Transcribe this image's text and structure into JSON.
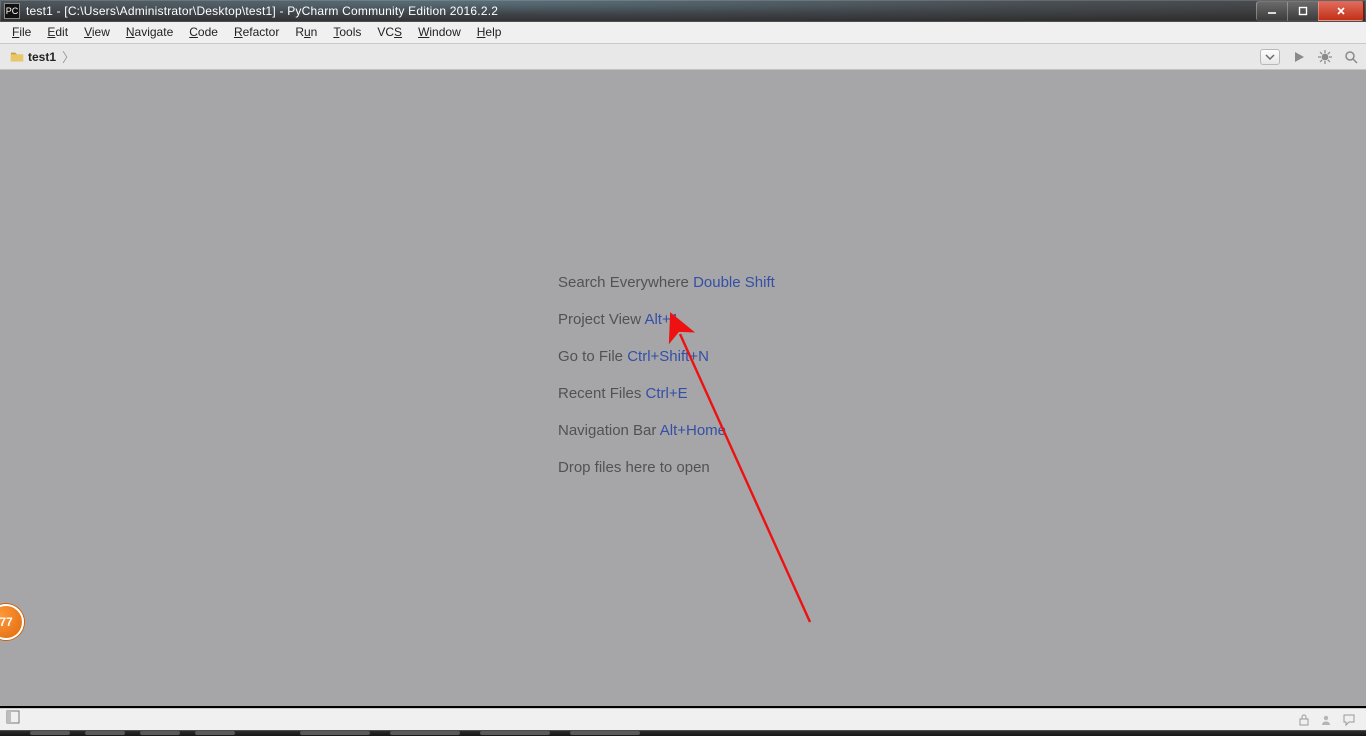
{
  "window": {
    "title": "test1 - [C:\\Users\\Administrator\\Desktop\\test1] - PyCharm Community Edition 2016.2.2",
    "app_icon_text": "PC"
  },
  "menu": {
    "items": [
      {
        "u": "F",
        "rest": "ile"
      },
      {
        "u": "E",
        "rest": "dit"
      },
      {
        "u": "V",
        "rest": "iew"
      },
      {
        "u": "N",
        "rest": "avigate"
      },
      {
        "u": "C",
        "rest": "ode"
      },
      {
        "u": "R",
        "rest": "efactor"
      },
      {
        "u": "",
        "rest": "R",
        "u2": "u",
        "rest2": "n"
      },
      {
        "u": "T",
        "rest": "ools"
      },
      {
        "u": "",
        "rest": "VC",
        "u2": "S",
        "rest2": ""
      },
      {
        "u": "W",
        "rest": "indow"
      },
      {
        "u": "H",
        "rest": "elp"
      }
    ]
  },
  "breadcrumb": {
    "project_name": "test1"
  },
  "editor_tips": {
    "rows": [
      {
        "label": "Search Everywhere ",
        "kbd": "Double Shift"
      },
      {
        "label": "Project View ",
        "kbd": "Alt+1"
      },
      {
        "label": "Go to File ",
        "kbd": "Ctrl+Shift+N"
      },
      {
        "label": "Recent Files ",
        "kbd": "Ctrl+E"
      },
      {
        "label": "Navigation Bar ",
        "kbd": "Alt+Home"
      },
      {
        "label": "Drop files here to open",
        "kbd": ""
      }
    ]
  },
  "badge": {
    "text": "77"
  }
}
